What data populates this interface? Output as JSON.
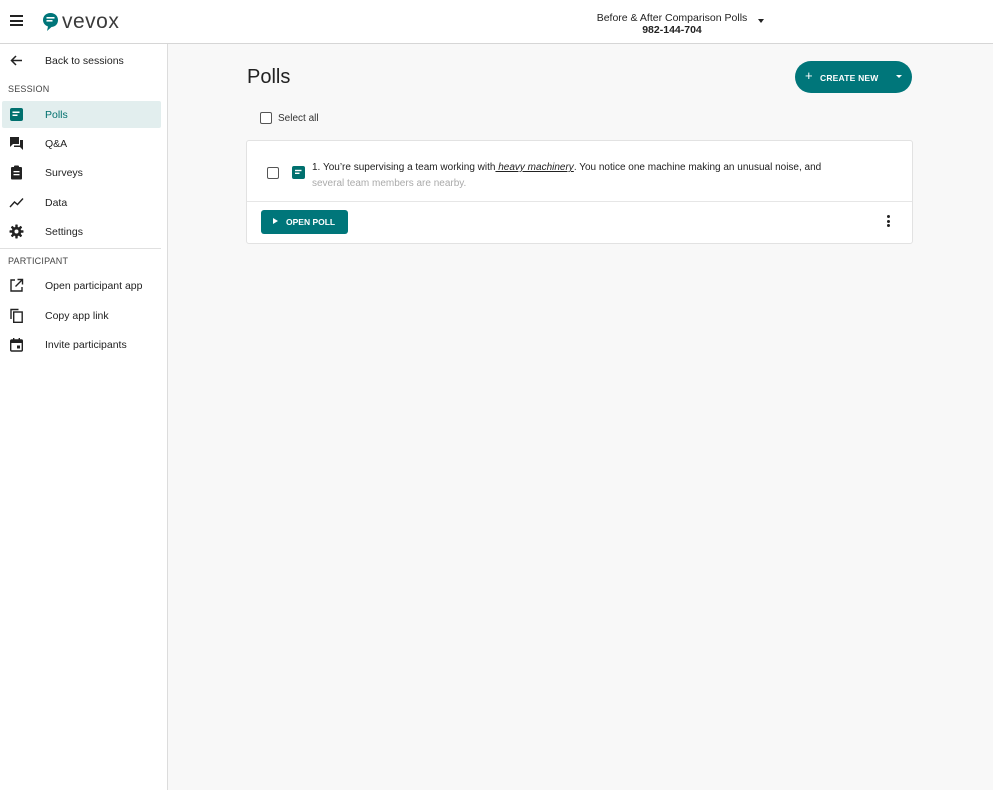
{
  "header": {
    "logo_text": "vevox",
    "session_title": "Before & After Comparison Polls",
    "session_code": "982-144-704",
    "brand_color": "#00767a"
  },
  "sidebar": {
    "back_label": "Back to sessions",
    "session_section": "SESSION",
    "session_items": [
      {
        "label": "Polls",
        "icon": "poll-icon",
        "active": true
      },
      {
        "label": "Q&A",
        "icon": "qa-icon",
        "active": false
      },
      {
        "label": "Surveys",
        "icon": "clipboard-icon",
        "active": false
      },
      {
        "label": "Data",
        "icon": "trend-icon",
        "active": false
      },
      {
        "label": "Settings",
        "icon": "gear-icon",
        "active": false
      }
    ],
    "participant_section": "PARTICIPANT",
    "participant_items": [
      {
        "label": "Open participant app",
        "icon": "external-link-icon"
      },
      {
        "label": "Copy app link",
        "icon": "copy-icon"
      },
      {
        "label": "Invite participants",
        "icon": "calendar-icon"
      }
    ]
  },
  "main": {
    "page_title": "Polls",
    "create_new_label": "CREATE NEW",
    "select_all_label": "Select all",
    "polls": [
      {
        "number": "1.",
        "text_before": " You’re supervising a team working with",
        "keyword": " heavy machinery",
        "text_after": ". You notice one machine making an unusual noise, and",
        "text_faded": "several team members are nearby.",
        "open_label": "OPEN POLL"
      }
    ]
  }
}
